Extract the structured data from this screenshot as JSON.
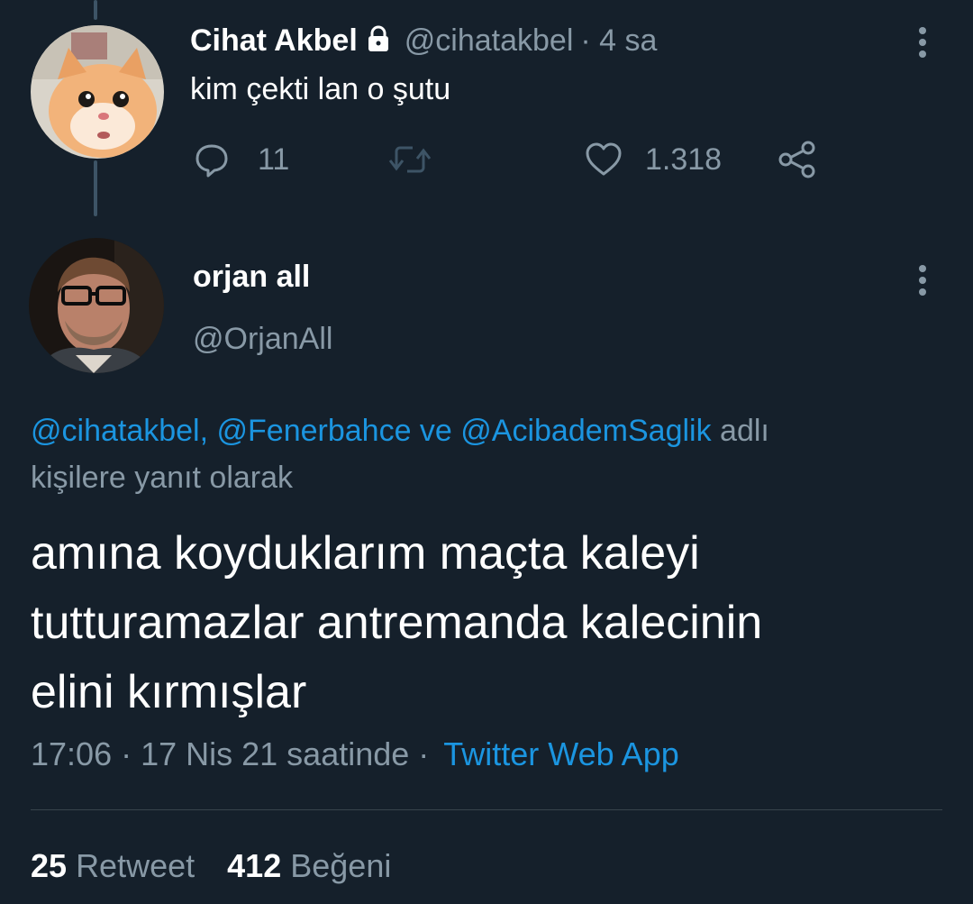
{
  "parent_tweet": {
    "display_name": "Cihat Akbel",
    "handle": "@cihatakbel",
    "time": "· 4 sa",
    "text": "kim çekti lan o şutu",
    "replies": "11",
    "likes": "1.318",
    "icons": [
      "lock-icon",
      "reply-icon",
      "retweet-icon",
      "like-icon",
      "share-icon",
      "more-icon"
    ]
  },
  "main_tweet": {
    "display_name": "orjan all",
    "handle": "@OrjanAll",
    "reply_context": {
      "mentions": "@cihatakbel, @Fenerbahce ve @AcibademSaglik",
      "suffix_line1": "adlı",
      "suffix_line2": "kişilere yanıt olarak"
    },
    "text_lines": [
      "amına koyduklarım maçta kaleyi",
      "tutturamazlar antremanda kalecinin",
      "elini kırmışlar"
    ],
    "timestamp": "17:06 · 17 Nis 21 saatinde ·",
    "source": "Twitter Web App",
    "stats": {
      "retweets_count": "25",
      "retweets_label": "Retweet",
      "likes_count": "412",
      "likes_label": "Beğeni"
    }
  },
  "colors": {
    "background": "#15202b",
    "text": "#ffffff",
    "muted": "#8899a6",
    "link": "#1b95e0",
    "divider": "#38444d"
  }
}
